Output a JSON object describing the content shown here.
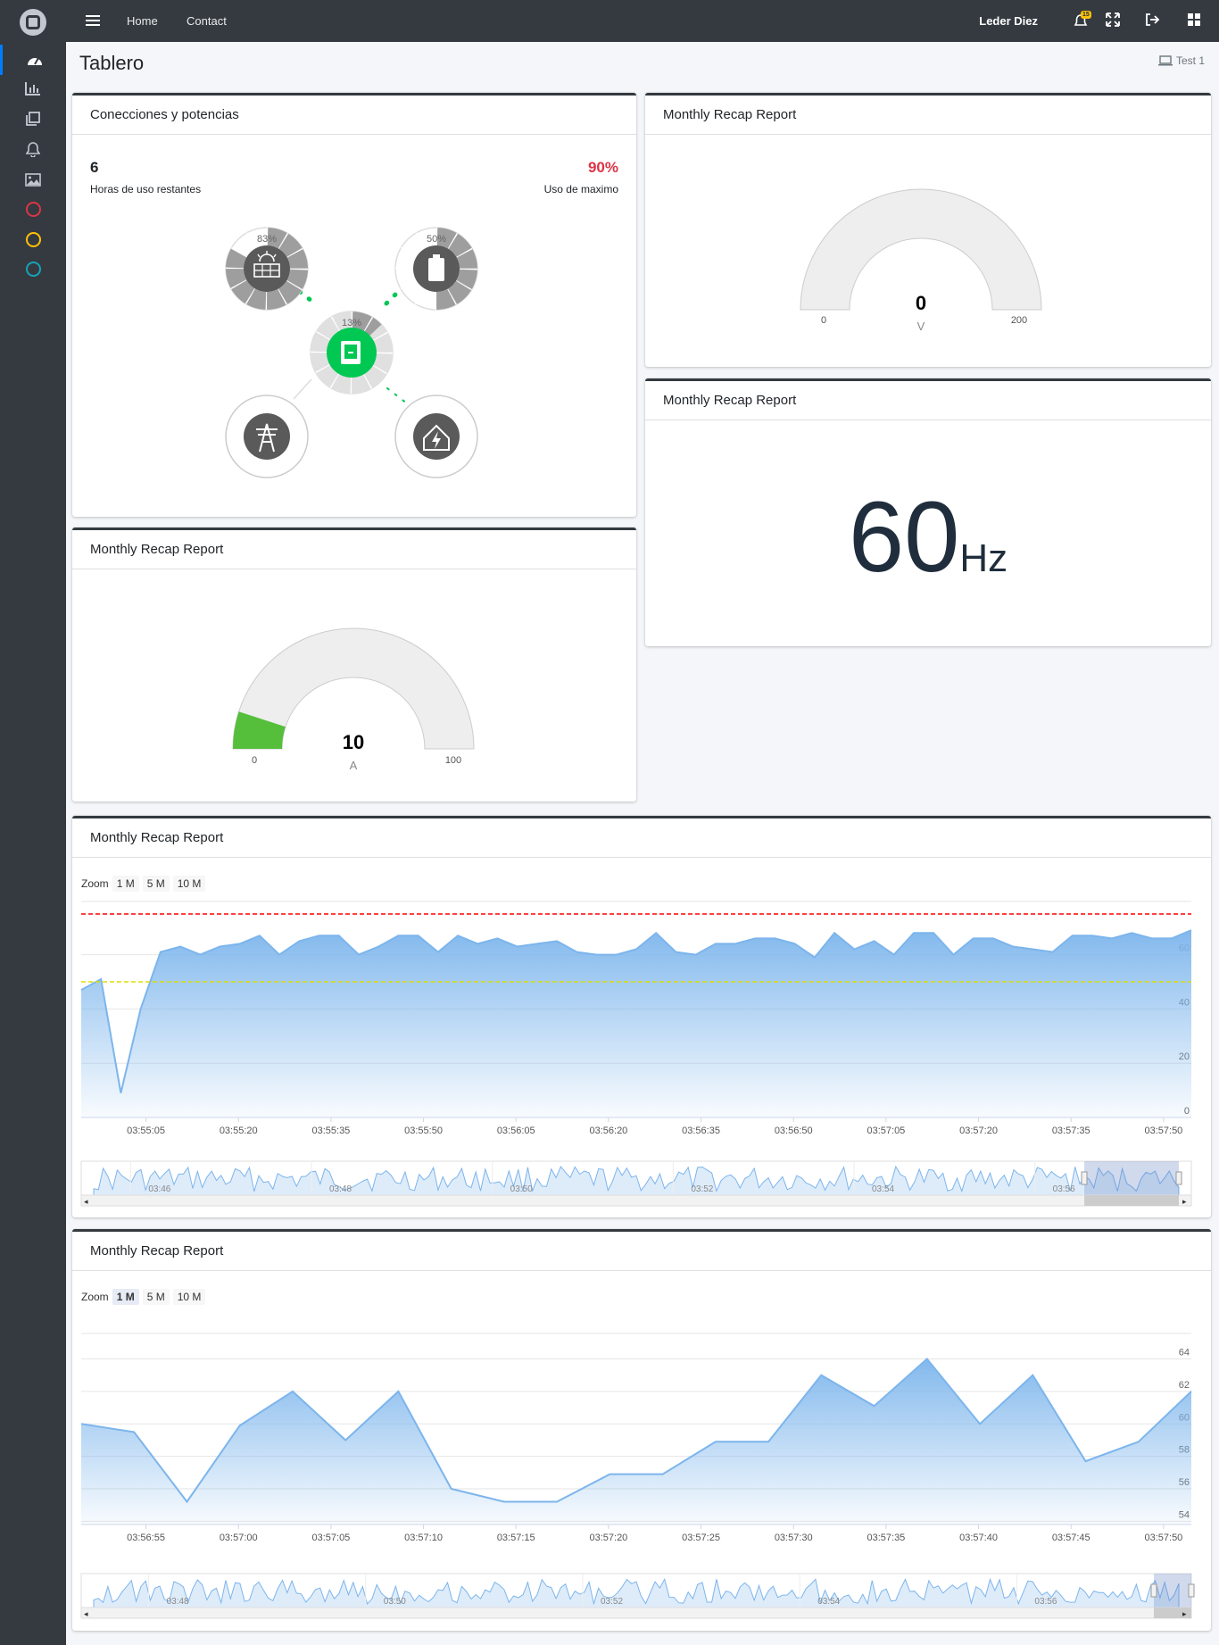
{
  "sidebar": {
    "items": [
      {
        "icon": "tachometer-icon"
      },
      {
        "icon": "bar-chart-icon"
      },
      {
        "icon": "copy-icon"
      },
      {
        "icon": "bell-icon"
      },
      {
        "icon": "image-icon"
      },
      {
        "icon": "circle-red-icon",
        "color": "#dc3545"
      },
      {
        "icon": "circle-yellow-icon",
        "color": "#ffc107"
      },
      {
        "icon": "circle-teal-icon",
        "color": "#17a2b8"
      }
    ]
  },
  "topbar": {
    "home": "Home",
    "contact": "Contact",
    "user": "Leder Diez",
    "notifications": "15"
  },
  "page": {
    "title": "Tablero",
    "crumb": "Test 1"
  },
  "connections": {
    "title": "Conecciones y potencias",
    "hours": "6",
    "hours_label": "Horas de uso restantes",
    "max_pct": "90%",
    "max_label": "Uso de maximo",
    "solar_pct": "83%",
    "battery_pct": "50%",
    "inverter_pct": "13%"
  },
  "voltage": {
    "title": "Monthly Recap Report",
    "value": "0",
    "unit": "V",
    "min": "0",
    "max": "200",
    "level": 0
  },
  "frequency": {
    "title": "Monthly Recap Report",
    "value": "60",
    "unit": "Hz"
  },
  "current": {
    "title": "Monthly Recap Report",
    "value": "10",
    "unit": "A",
    "min": "0",
    "max": "100",
    "level": 0.1
  },
  "chart1": {
    "title": "Monthly Recap Report",
    "zoom_label": "Zoom",
    "zoom_options": [
      "1 M",
      "5 M",
      "10 M"
    ],
    "nav_labels": [
      "03:46",
      "03:48",
      "03:50",
      "03:52",
      "03:54",
      "03:56"
    ],
    "chart_data": {
      "type": "area",
      "x_ticks": [
        "03:55:05",
        "03:55:20",
        "03:55:35",
        "03:55:50",
        "03:56:05",
        "03:56:20",
        "03:56:35",
        "03:56:50",
        "03:57:05",
        "03:57:20",
        "03:57:35",
        "03:57:50"
      ],
      "y_ticks": [
        "0",
        "20",
        "40",
        "60"
      ],
      "ylim": [
        0,
        75
      ],
      "thresholds": [
        {
          "value": 75,
          "color": "#ff0000"
        },
        {
          "value": 50,
          "color": "#dddd00"
        }
      ],
      "values": [
        47,
        51,
        9,
        40,
        61,
        63,
        60,
        63,
        64,
        67,
        60,
        65,
        67,
        67,
        60,
        63,
        67,
        67,
        61,
        67,
        64,
        66,
        63,
        64,
        65,
        61,
        60,
        60,
        62,
        68,
        61,
        60,
        64,
        64,
        66,
        66,
        64,
        59,
        68,
        62,
        65,
        60,
        68,
        68,
        60,
        66,
        66,
        63,
        62,
        61,
        67,
        67,
        66,
        68,
        66,
        66,
        69
      ]
    }
  },
  "chart2": {
    "title": "Monthly Recap Report",
    "zoom_label": "Zoom",
    "zoom_options": [
      "1 M",
      "5 M",
      "10 M"
    ],
    "nav_labels": [
      "03:48",
      "03:50",
      "03:52",
      "03:54",
      "03:56"
    ],
    "chart_data": {
      "type": "area",
      "x_ticks": [
        "03:56:55",
        "03:57:00",
        "03:57:05",
        "03:57:10",
        "03:57:15",
        "03:57:20",
        "03:57:25",
        "03:57:30",
        "03:57:35",
        "03:57:40",
        "03:57:45",
        "03:57:50"
      ],
      "y_ticks": [
        "54",
        "56",
        "58",
        "60",
        "62",
        "64"
      ],
      "ylim": [
        53.8,
        64.8
      ],
      "values": [
        60,
        59.5,
        55.2,
        59.9,
        62,
        59,
        62,
        56,
        55.2,
        55.2,
        56.9,
        56.9,
        58.9,
        58.9,
        63,
        61.1,
        64,
        60,
        63,
        57.7,
        58.9,
        62
      ]
    }
  }
}
